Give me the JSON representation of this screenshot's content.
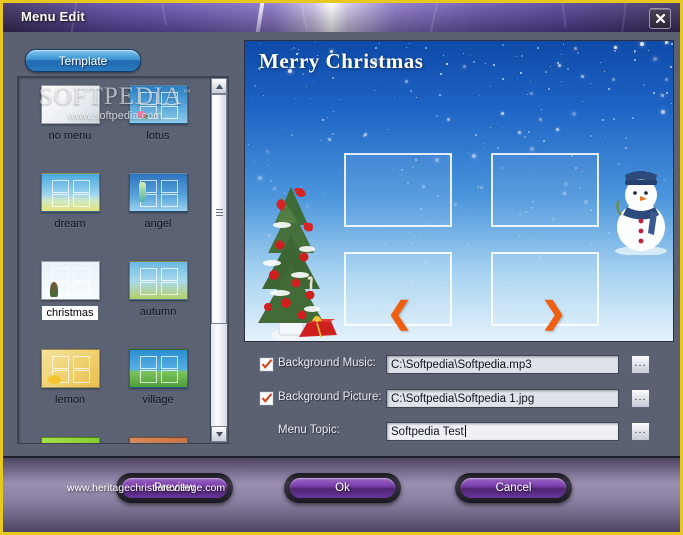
{
  "window": {
    "title": "Menu Edit",
    "close_icon": "close-icon",
    "border_color": "#e8c81e"
  },
  "left_panel": {
    "template_button": "Template",
    "templates": [
      {
        "label": "no menu",
        "art": "art-nomenu",
        "frames": false,
        "selected": false
      },
      {
        "label": "lotus",
        "art": "art-lotus",
        "frames": true,
        "selected": false
      },
      {
        "label": "dream",
        "art": "art-dream",
        "frames": true,
        "selected": false
      },
      {
        "label": "angel",
        "art": "art-angel",
        "frames": true,
        "selected": false
      },
      {
        "label": "christmas",
        "art": "art-christmas",
        "frames": true,
        "selected": true
      },
      {
        "label": "autumn",
        "art": "art-autumn",
        "frames": true,
        "selected": false
      },
      {
        "label": "lemon",
        "art": "art-lemon",
        "frames": true,
        "selected": false
      },
      {
        "label": "village",
        "art": "art-village",
        "frames": true,
        "selected": false
      },
      {
        "label": "",
        "art": "art-green",
        "frames": true,
        "selected": false
      },
      {
        "label": "",
        "art": "art-orange",
        "frames": true,
        "selected": false
      }
    ],
    "watermark": {
      "brand": "SOFTPEDIA",
      "tm": "™",
      "url": "www.softpedia.com"
    },
    "scrollbar": {
      "up_icon": "scroll-up-icon",
      "down_icon": "scroll-down-icon"
    }
  },
  "preview": {
    "title": "Merry Christmas",
    "prev_arrow": "❮",
    "next_arrow": "❯",
    "frame_count": 4
  },
  "form": {
    "background_music": {
      "label": "Background Music:",
      "checked": true,
      "value": "C:\\Softpedia\\Softpedia.mp3",
      "browse": "..."
    },
    "background_picture": {
      "label": "Background Picture:",
      "checked": true,
      "value": "C:\\Softpedia\\Softpedia 1.jpg",
      "browse": "..."
    },
    "menu_topic": {
      "label": "Menu Topic:",
      "value": "Softpedia Test",
      "browse": "..."
    }
  },
  "footer": {
    "preview_button": "Preview",
    "ok_button": "Ok",
    "cancel_button": "Cancel",
    "watermark": "www.heritagechristiancollege.com"
  }
}
